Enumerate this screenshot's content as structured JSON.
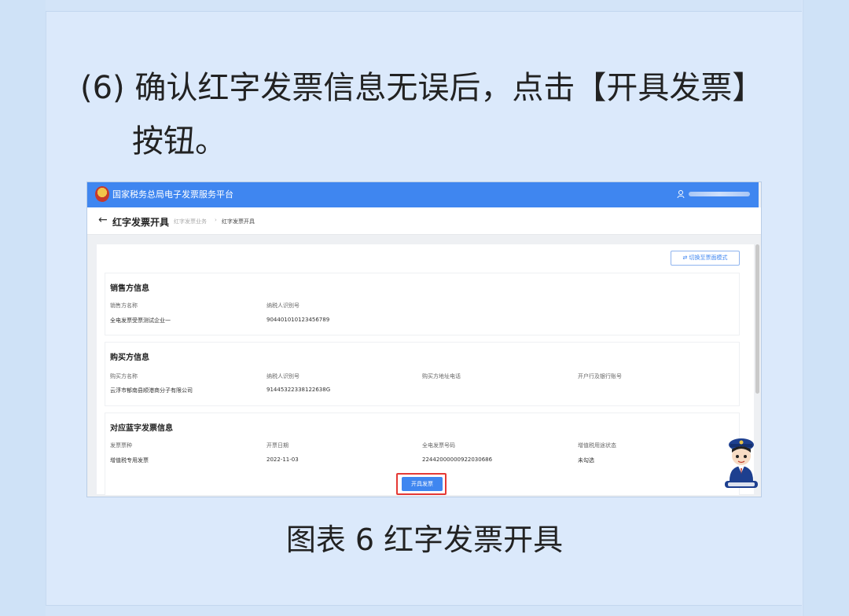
{
  "instruction": {
    "line1": "(6) 确认红字发票信息无误后，点击【开具发票】",
    "line2": "按钮。"
  },
  "caption": "图表 6 红字发票开具",
  "app": {
    "title": "国家税务总局电子发票服务平台",
    "page_title": "红字发票开具",
    "breadcrumb": [
      "红字发票业务",
      "红字发票开具"
    ],
    "breadcrumb_sep": "›",
    "back_glyph": "←",
    "switch_mode_label": "⇄ 切换至票面模式",
    "issue_button_label": "开具发票"
  },
  "seller": {
    "title": "销售方信息",
    "name_label": "销售方名称",
    "name_value": "全电发票受票测试企业一",
    "tax_id_label": "纳税人识别号",
    "tax_id_value": "904401010123456789"
  },
  "buyer": {
    "title": "购买方信息",
    "name_label": "购买方名称",
    "name_value": "云浮市郁南县顺港商分子有限公司",
    "tax_id_label": "纳税人识别号",
    "tax_id_value": "91445322338122638G",
    "address_label": "购买方地址电话",
    "bank_label": "开户行及银行账号"
  },
  "blue_invoice": {
    "title": "对应蓝字发票信息",
    "type_label": "发票票种",
    "type_value": "增值税专用发票",
    "date_label": "开票日期",
    "date_value": "2022-11-03",
    "number_label": "全电发票号码",
    "number_value": "22442000000922030686",
    "status_label": "增值税用途状态",
    "status_value": "未勾选"
  },
  "colors": {
    "accent": "#3f86f0",
    "highlight": "#e53935",
    "background": "#dbe9fb"
  }
}
